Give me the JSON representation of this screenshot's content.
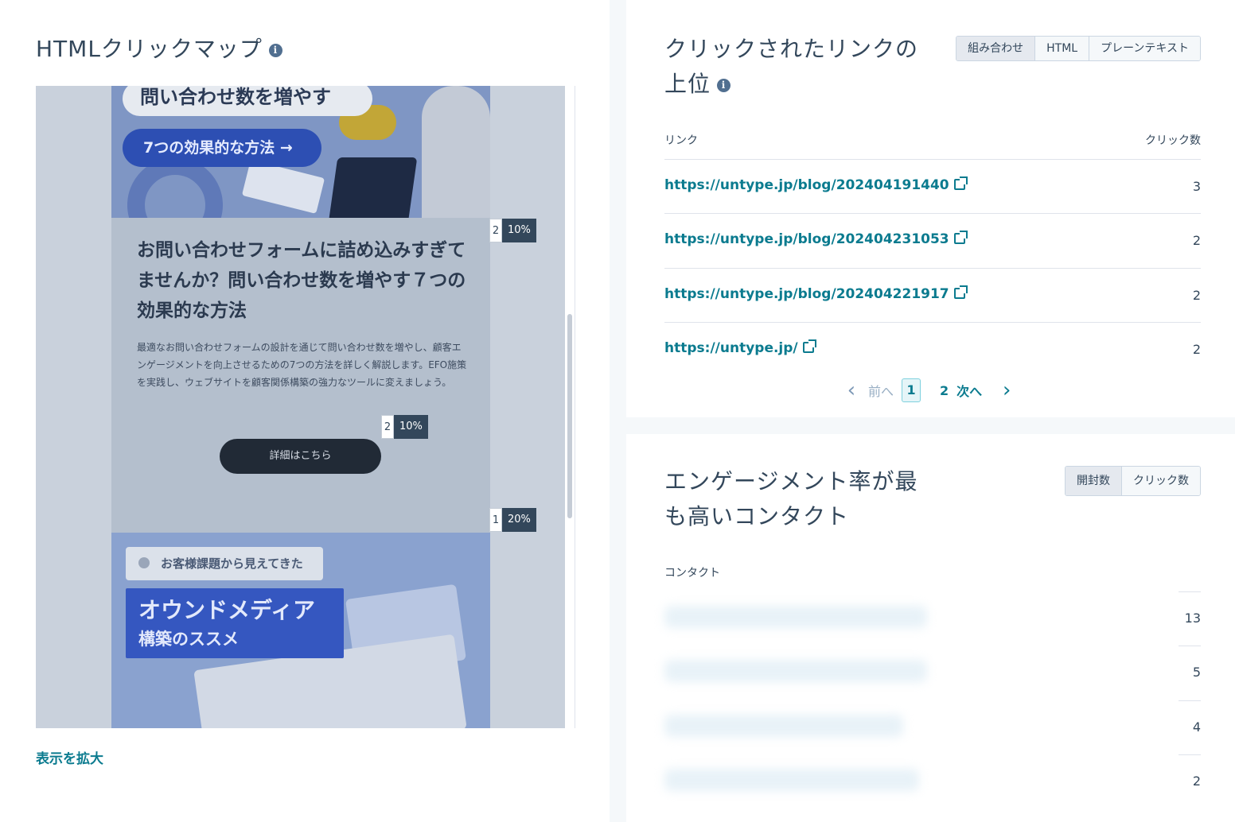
{
  "heatmap": {
    "title": "HTMLクリックマップ",
    "info": "i",
    "expand_link": "表示を拡大",
    "preview": {
      "hero_title": "問い合わせ数を増やす",
      "hero_pill": "7つの効果的な方法 →",
      "article_title": "お問い合わせフォームに詰め込みすぎてませんか？問い合わせ数を増やす７つの効果的な方法",
      "article_body": "最適なお問い合わせフォームの設計を通じて問い合わせ数を増やし、顧客エンゲージメントを向上させるための7つの方法を詳しく解説します。EFO施策を実践し、ウェブサイトを顧客関係構築の強力なツールに変えましょう。",
      "button": "詳細はこちら",
      "tag": "お客様課題から見えてきた",
      "box_big": "オウンドメディア",
      "box_small": "構築のススメ"
    },
    "badges": [
      {
        "count": "2",
        "percent": "10%"
      },
      {
        "count": "2",
        "percent": "10%"
      },
      {
        "count": "1",
        "percent": "20%"
      }
    ]
  },
  "links": {
    "title_line1": "クリックされたリンクの",
    "title_line2": "上位",
    "info": "i",
    "toggle": [
      "組み合わせ",
      "HTML",
      "プレーンテキスト"
    ],
    "toggle_active": "組み合わせ",
    "col_link": "リンク",
    "col_clicks": "クリック数",
    "rows": [
      {
        "url": "https://untype.jp/blog/202404191440",
        "clicks": "3"
      },
      {
        "url": "https://untype.jp/blog/202404231053",
        "clicks": "2"
      },
      {
        "url": "https://untype.jp/blog/202404221917",
        "clicks": "2"
      },
      {
        "url": "https://untype.jp/",
        "clicks": "2"
      }
    ],
    "pager": {
      "prev": "前へ",
      "current": "1",
      "page2": "2",
      "next": "次へ",
      "prev_icon": "‹",
      "next_icon": "›"
    }
  },
  "contacts": {
    "title_line1": "エンゲージメント率が最",
    "title_line2": "も高いコンタクト",
    "toggle": [
      "開封数",
      "クリック数"
    ],
    "toggle_active": "開封数",
    "col_contact": "コンタクト",
    "rows": [
      {
        "count": "13"
      },
      {
        "count": "5"
      },
      {
        "count": "4"
      },
      {
        "count": "2"
      }
    ]
  }
}
